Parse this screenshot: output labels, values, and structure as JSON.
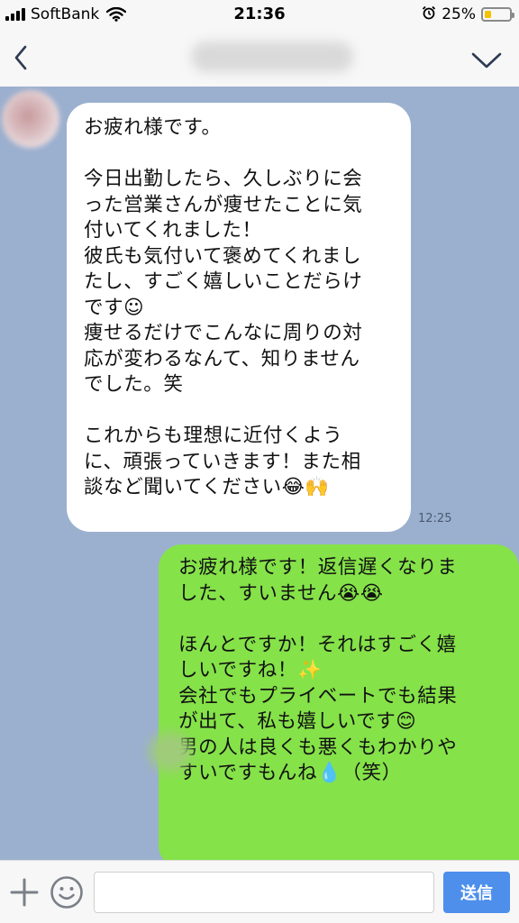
{
  "status_bar": {
    "carrier": "SoftBank",
    "time": "21:36",
    "battery_percent": "25%",
    "battery_level": 0.25,
    "icons": [
      "signal-icon",
      "wifi-icon",
      "alarm-icon",
      "battery-icon"
    ]
  },
  "header": {
    "contact_name": "",
    "icons": [
      "back-chevron-icon",
      "menu-chevron-icon"
    ]
  },
  "messages": [
    {
      "direction": "incoming",
      "time": "12:25",
      "lines": [
        "お疲れ様です。",
        "",
        "今日出勤したら、久しぶりに会",
        "った営業さんが痩せたことに気",
        "付いてくれました！",
        "彼氏も気付いて褒めてくれまし",
        "たし、すごく嬉しいことだらけ",
        "です☺",
        "痩せるだけでこんなに周りの対",
        "応が変わるなんて、知りません",
        "でした。笑",
        "",
        "これからも理想に近付くよう",
        "に、頑張っていきます！また相",
        "談など聞いてください😂🙌"
      ]
    },
    {
      "direction": "outgoing",
      "lines": [
        "お疲れ様です！返信遅くなりま",
        "した、すいません😭😭",
        "",
        "ほんとですか！それはすごく嬉",
        "しいですね！✨",
        "会社でもプライベートでも結果",
        "が出て、私も嬉しいです😊",
        "男の人は良くも悪くもわかりや",
        "すいですもんね💧（笑）"
      ]
    }
  ],
  "input_bar": {
    "placeholder": "",
    "send_label": "送信",
    "icons": [
      "plus-icon",
      "smiley-icon"
    ]
  },
  "colors": {
    "chat_background": "#9BB0CF",
    "incoming_bubble": "#FFFFFF",
    "outgoing_bubble": "#85E249",
    "send_button": "#4D8FEB"
  }
}
